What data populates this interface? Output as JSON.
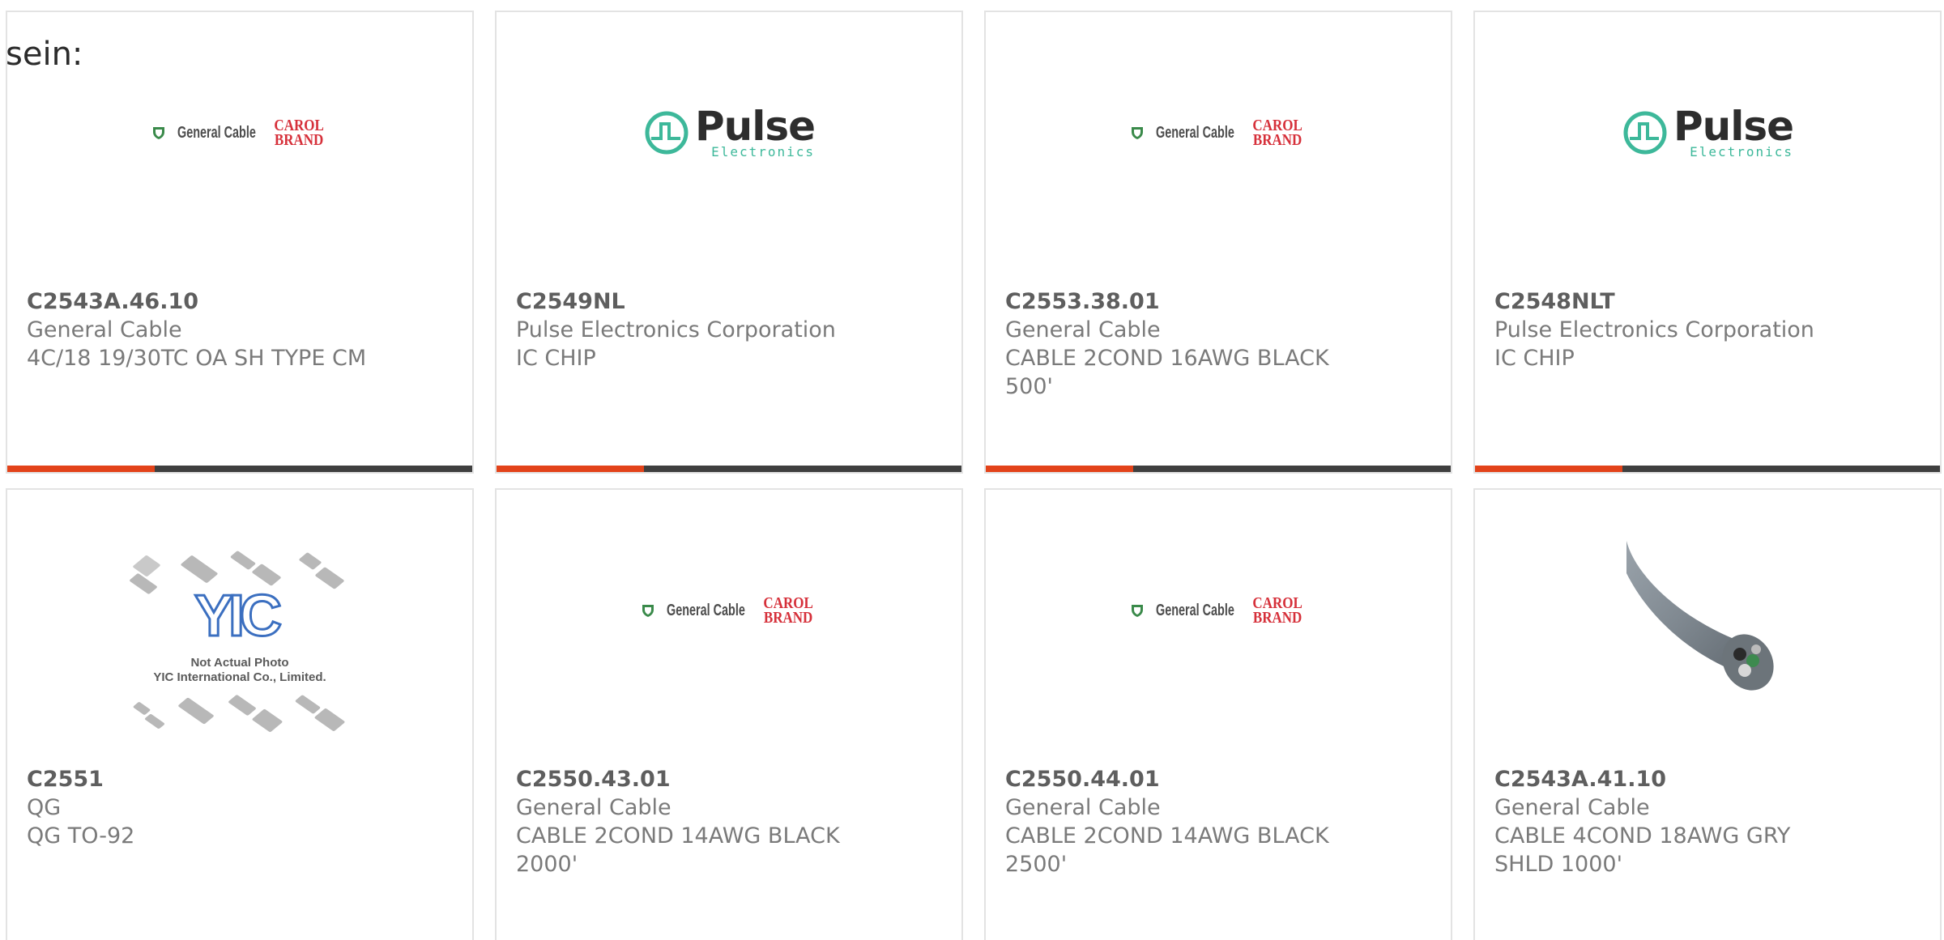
{
  "header": {
    "label": "sein:"
  },
  "products": [
    {
      "part": "C2543A.46.10",
      "maker": "General Cable",
      "desc": "4C/18 19/30TC OA SH TYPE CM",
      "logo": "general-cable-carol"
    },
    {
      "part": "C2549NL",
      "maker": "Pulse Electronics Corporation",
      "desc": "IC CHIP",
      "logo": "pulse-electronics"
    },
    {
      "part": "C2553.38.01",
      "maker": "General Cable",
      "desc": "CABLE 2COND 16AWG BLACK 500'",
      "logo": "general-cable-carol"
    },
    {
      "part": "C2548NLT",
      "maker": "Pulse Electronics Corporation",
      "desc": "IC CHIP",
      "logo": "pulse-electronics"
    },
    {
      "part": "C2551",
      "maker": "QG",
      "desc": "QG TO-92",
      "logo": "yic-not-actual-photo"
    },
    {
      "part": "C2550.43.01",
      "maker": "General Cable",
      "desc": "CABLE 2COND 14AWG BLACK 2000'",
      "logo": "general-cable-carol"
    },
    {
      "part": "C2550.44.01",
      "maker": "General Cable",
      "desc": "CABLE 2COND 14AWG BLACK 2500'",
      "logo": "general-cable-carol"
    },
    {
      "part": "C2543A.41.10",
      "maker": "General Cable",
      "desc": "CABLE 4COND 18AWG GRY SHLD 1000'",
      "logo": "cable-photo"
    }
  ],
  "logos": {
    "general_cable_text": "General Cable",
    "carol_line1": "CAROL",
    "carol_line2": "BRAND",
    "pulse_word": "Pulse",
    "pulse_sub": "Electronics",
    "yic_mark": "YIC",
    "yic_caption_1": "Not Actual Photo",
    "yic_caption_2": "YIC International Co., Limited."
  },
  "colors": {
    "accent": "#e3431a",
    "bar": "#3f3f3f",
    "carol_red": "#d6303a",
    "pulse_green": "#3db89a",
    "yic_blue": "#3b6fc0"
  }
}
